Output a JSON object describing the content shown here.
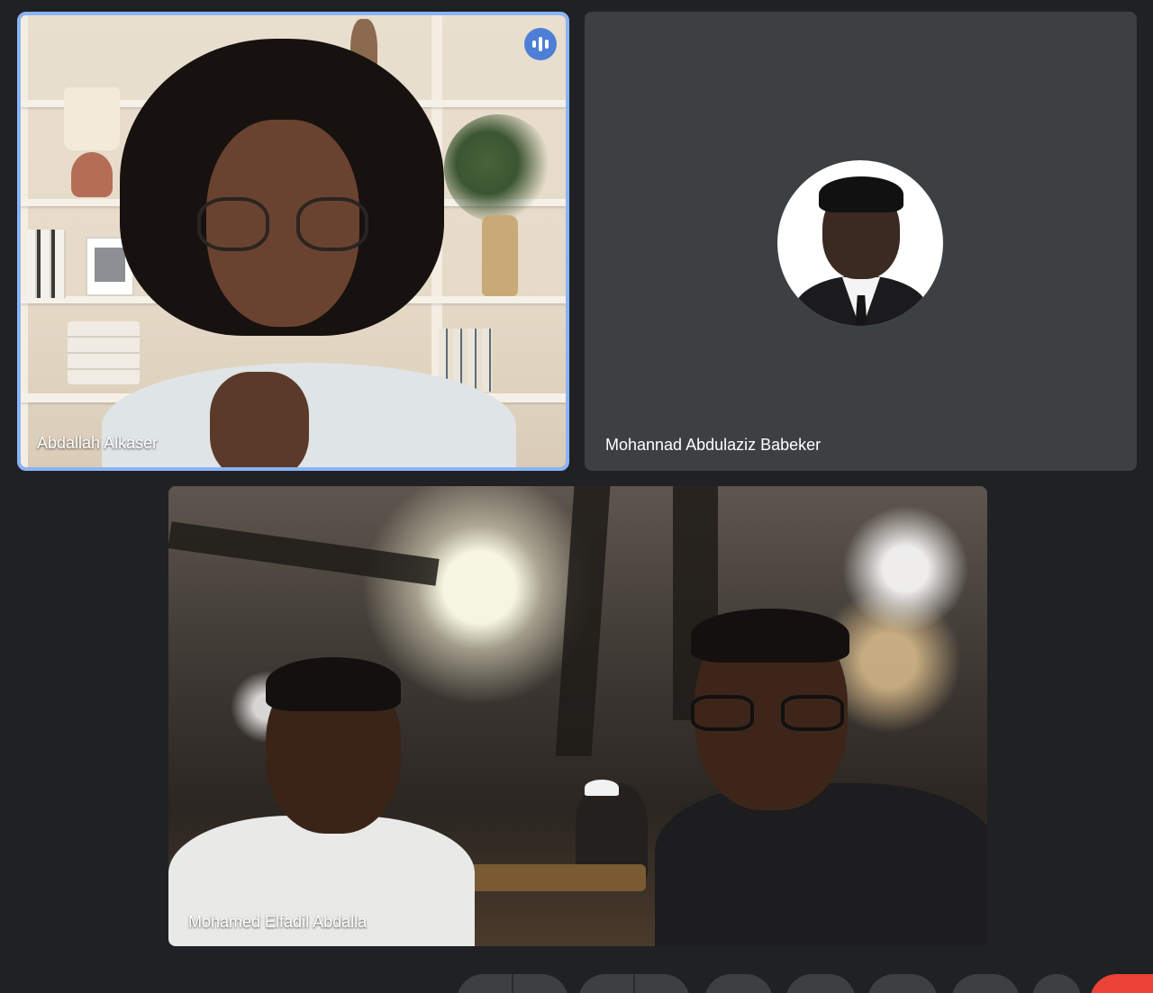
{
  "participants": [
    {
      "name": "Abdallah Alkaser",
      "speaking": true,
      "video": "on"
    },
    {
      "name": "Mohannad Abdulaziz Babeker",
      "speaking": false,
      "video": "off"
    },
    {
      "name": "Mohamed Elfadil Abdalla",
      "speaking": false,
      "video": "on"
    }
  ],
  "colors": {
    "background": "#202124",
    "tile": "#3c4043",
    "active_speaker_border": "#8ab4f8",
    "speaking_indicator": "#4d7fd6",
    "leave_button": "#ea4335"
  },
  "icons": {
    "speaking": "audio-level-icon"
  }
}
